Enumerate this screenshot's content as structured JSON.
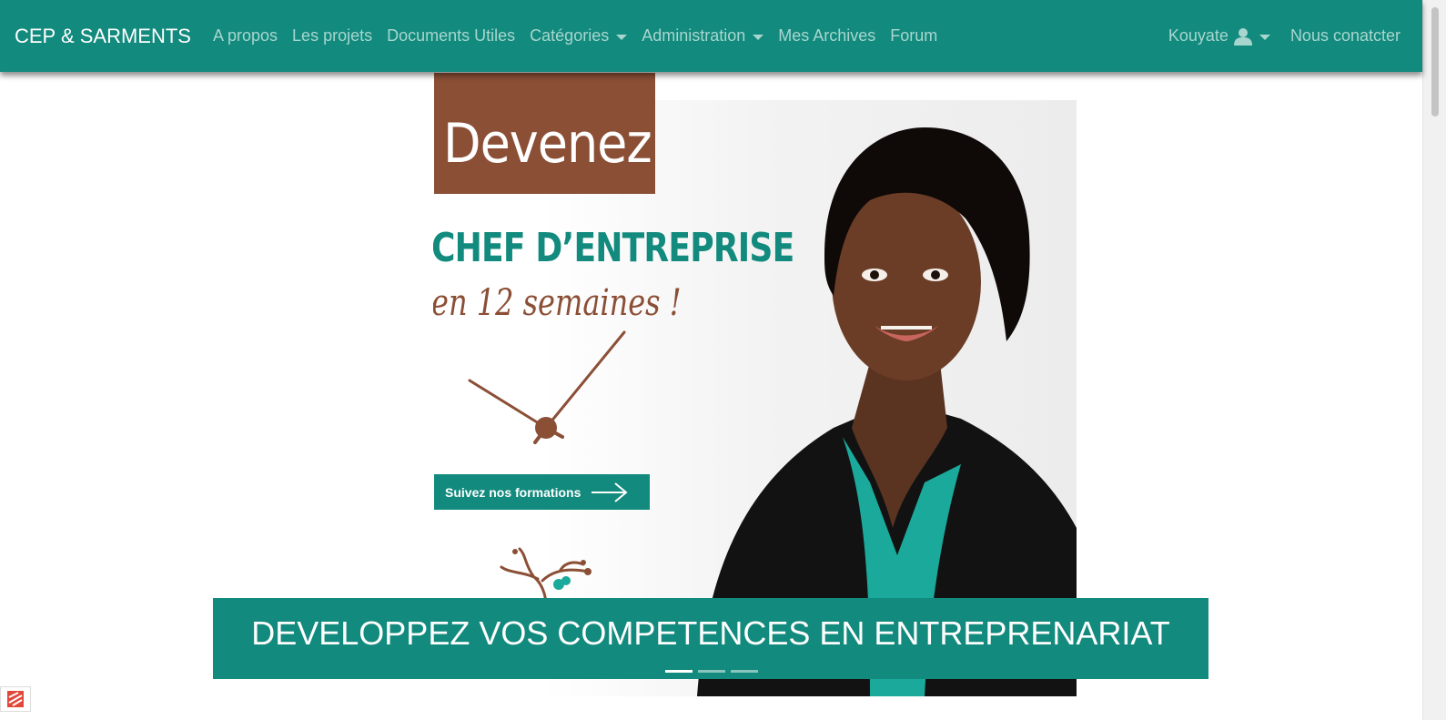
{
  "navbar": {
    "brand": "CEP & SARMENTS",
    "links": [
      {
        "label": "A propos"
      },
      {
        "label": "Les projets"
      },
      {
        "label": "Documents Utiles"
      },
      {
        "label": "Catégories"
      },
      {
        "label": "Administration"
      },
      {
        "label": "Mes Archives"
      },
      {
        "label": "Forum"
      }
    ],
    "user": "Kouyate",
    "contact": "Nous conatcter"
  },
  "hero": {
    "devenez": "Devenez",
    "headline": "CHEF D’ENTREPRISE",
    "subline": "en 12 semaines !",
    "cta": "Suivez nos formations"
  },
  "carousel": {
    "caption": "DEVELOPPEZ VOS COMPETENCES EN ENTREPRENARIAT",
    "slide_count": 3,
    "active_index": 0
  },
  "colors": {
    "primary": "#128a7d",
    "brown": "#8b4f36",
    "nav_text": "#a7d6cf"
  },
  "icons": {
    "user": "user-icon",
    "caret": "caret-down-icon",
    "arrow": "arrow-right-icon"
  }
}
